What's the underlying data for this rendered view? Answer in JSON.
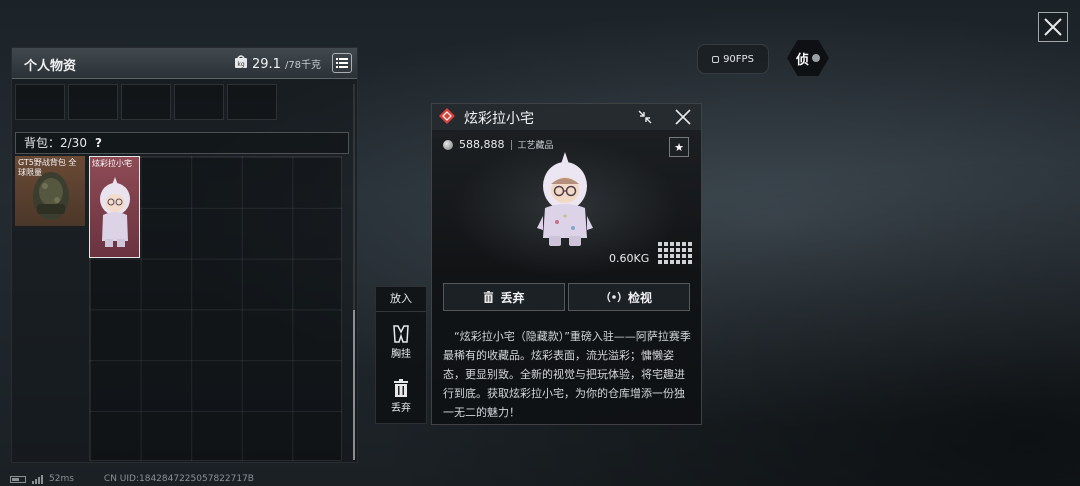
{
  "top_right": {
    "fps": "90FPS",
    "status_char": "侦"
  },
  "left_panel": {
    "title": "个人物资",
    "weight_current": "29.1",
    "weight_max": "/78千克",
    "backpack_label": "背包：2/30",
    "help": "?",
    "gear_item_label": "GT5野战背包 全球限量",
    "doll_item_label": "炫彩拉小宅"
  },
  "side_actions": {
    "header": "放入",
    "hang_label": "胸挂",
    "discard_label": "丢弃"
  },
  "detail": {
    "title": "炫彩拉小宅",
    "price": "588,888",
    "category": "工艺藏品",
    "weight": "0.60KG",
    "discard_button": "丢弃",
    "inspect_button": "检视",
    "description": "“炫彩拉小宅（隐藏款）”重磅入驻——阿萨拉赛季最稀有的收藏品。炫彩表面，流光溢彩；慵懒姿态，更显别致。全新的视觉与把玩体验，将宅趣进行到底。获取炫彩拉小宅，为你的仓库增添一份独一无二的魅力！"
  },
  "status": {
    "ping": "52ms",
    "uid": "CN UID:1842847225057822717B"
  },
  "colors": {
    "rarity_accent": "#d9403a",
    "gear_slot": "#6b4a36",
    "doll_slot": "#8e4b55"
  }
}
